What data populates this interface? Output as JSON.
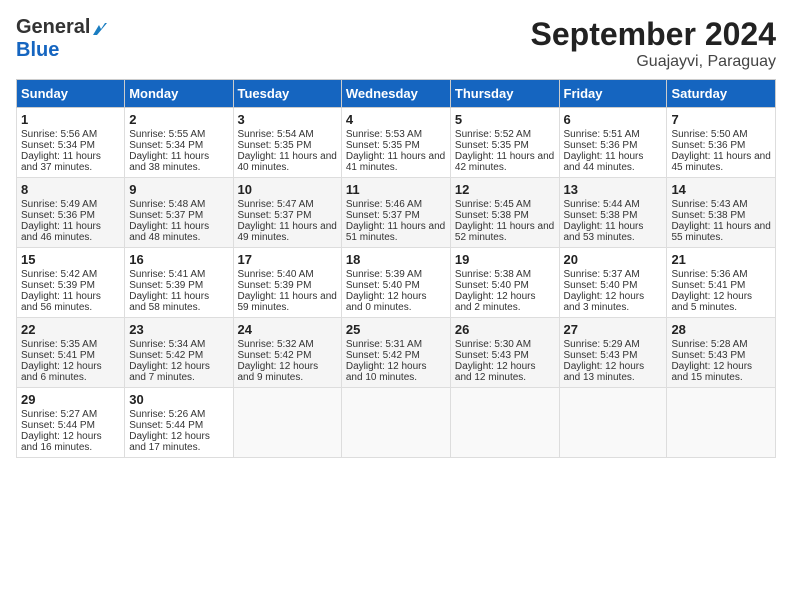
{
  "header": {
    "logo_general": "General",
    "logo_blue": "Blue",
    "month": "September 2024",
    "location": "Guajayvi, Paraguay"
  },
  "weekdays": [
    "Sunday",
    "Monday",
    "Tuesday",
    "Wednesday",
    "Thursday",
    "Friday",
    "Saturday"
  ],
  "weeks": [
    [
      {
        "day": "1",
        "sunrise": "5:56 AM",
        "sunset": "5:34 PM",
        "daylight": "11 hours and 37 minutes."
      },
      {
        "day": "2",
        "sunrise": "5:55 AM",
        "sunset": "5:34 PM",
        "daylight": "11 hours and 38 minutes."
      },
      {
        "day": "3",
        "sunrise": "5:54 AM",
        "sunset": "5:35 PM",
        "daylight": "11 hours and 40 minutes."
      },
      {
        "day": "4",
        "sunrise": "5:53 AM",
        "sunset": "5:35 PM",
        "daylight": "11 hours and 41 minutes."
      },
      {
        "day": "5",
        "sunrise": "5:52 AM",
        "sunset": "5:35 PM",
        "daylight": "11 hours and 42 minutes."
      },
      {
        "day": "6",
        "sunrise": "5:51 AM",
        "sunset": "5:36 PM",
        "daylight": "11 hours and 44 minutes."
      },
      {
        "day": "7",
        "sunrise": "5:50 AM",
        "sunset": "5:36 PM",
        "daylight": "11 hours and 45 minutes."
      }
    ],
    [
      {
        "day": "8",
        "sunrise": "5:49 AM",
        "sunset": "5:36 PM",
        "daylight": "11 hours and 46 minutes."
      },
      {
        "day": "9",
        "sunrise": "5:48 AM",
        "sunset": "5:37 PM",
        "daylight": "11 hours and 48 minutes."
      },
      {
        "day": "10",
        "sunrise": "5:47 AM",
        "sunset": "5:37 PM",
        "daylight": "11 hours and 49 minutes."
      },
      {
        "day": "11",
        "sunrise": "5:46 AM",
        "sunset": "5:37 PM",
        "daylight": "11 hours and 51 minutes."
      },
      {
        "day": "12",
        "sunrise": "5:45 AM",
        "sunset": "5:38 PM",
        "daylight": "11 hours and 52 minutes."
      },
      {
        "day": "13",
        "sunrise": "5:44 AM",
        "sunset": "5:38 PM",
        "daylight": "11 hours and 53 minutes."
      },
      {
        "day": "14",
        "sunrise": "5:43 AM",
        "sunset": "5:38 PM",
        "daylight": "11 hours and 55 minutes."
      }
    ],
    [
      {
        "day": "15",
        "sunrise": "5:42 AM",
        "sunset": "5:39 PM",
        "daylight": "11 hours and 56 minutes."
      },
      {
        "day": "16",
        "sunrise": "5:41 AM",
        "sunset": "5:39 PM",
        "daylight": "11 hours and 58 minutes."
      },
      {
        "day": "17",
        "sunrise": "5:40 AM",
        "sunset": "5:39 PM",
        "daylight": "11 hours and 59 minutes."
      },
      {
        "day": "18",
        "sunrise": "5:39 AM",
        "sunset": "5:40 PM",
        "daylight": "12 hours and 0 minutes."
      },
      {
        "day": "19",
        "sunrise": "5:38 AM",
        "sunset": "5:40 PM",
        "daylight": "12 hours and 2 minutes."
      },
      {
        "day": "20",
        "sunrise": "5:37 AM",
        "sunset": "5:40 PM",
        "daylight": "12 hours and 3 minutes."
      },
      {
        "day": "21",
        "sunrise": "5:36 AM",
        "sunset": "5:41 PM",
        "daylight": "12 hours and 5 minutes."
      }
    ],
    [
      {
        "day": "22",
        "sunrise": "5:35 AM",
        "sunset": "5:41 PM",
        "daylight": "12 hours and 6 minutes."
      },
      {
        "day": "23",
        "sunrise": "5:34 AM",
        "sunset": "5:42 PM",
        "daylight": "12 hours and 7 minutes."
      },
      {
        "day": "24",
        "sunrise": "5:32 AM",
        "sunset": "5:42 PM",
        "daylight": "12 hours and 9 minutes."
      },
      {
        "day": "25",
        "sunrise": "5:31 AM",
        "sunset": "5:42 PM",
        "daylight": "12 hours and 10 minutes."
      },
      {
        "day": "26",
        "sunrise": "5:30 AM",
        "sunset": "5:43 PM",
        "daylight": "12 hours and 12 minutes."
      },
      {
        "day": "27",
        "sunrise": "5:29 AM",
        "sunset": "5:43 PM",
        "daylight": "12 hours and 13 minutes."
      },
      {
        "day": "28",
        "sunrise": "5:28 AM",
        "sunset": "5:43 PM",
        "daylight": "12 hours and 15 minutes."
      }
    ],
    [
      {
        "day": "29",
        "sunrise": "5:27 AM",
        "sunset": "5:44 PM",
        "daylight": "12 hours and 16 minutes."
      },
      {
        "day": "30",
        "sunrise": "5:26 AM",
        "sunset": "5:44 PM",
        "daylight": "12 hours and 17 minutes."
      },
      null,
      null,
      null,
      null,
      null
    ]
  ]
}
